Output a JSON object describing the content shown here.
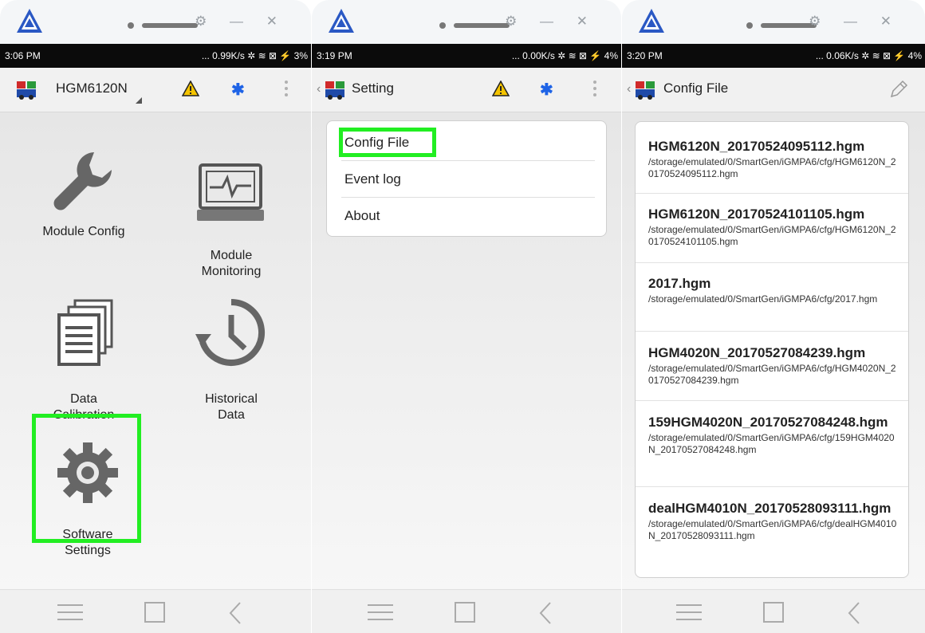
{
  "panels": [
    {
      "status": {
        "time": "3:06 PM",
        "right": "... 0.99K/s ✲ ≋ ⊠ ⚡ 3%"
      },
      "appbar": {
        "title": "HGM6120N"
      },
      "tiles": [
        "Module Config",
        "Module\nMonitoring",
        "Data\nCalibration",
        "Historical\nData",
        "Software\nSettings"
      ]
    },
    {
      "status": {
        "time": "3:19 PM",
        "right": "... 0.00K/s ✲ ≋ ⊠ ⚡ 4%"
      },
      "appbar": {
        "title": "Setting"
      },
      "menu": [
        "Config File",
        "Event log",
        "About"
      ]
    },
    {
      "status": {
        "time": "3:20 PM",
        "right": "... 0.06K/s ✲ ≋ ⊠ ⚡ 4%"
      },
      "appbar": {
        "title": "Config File"
      },
      "files": [
        {
          "name": "HGM6120N_20170524095112.hgm",
          "path": "/storage/emulated/0/SmartGen/iGMPA6/cfg/HGM6120N_20170524095112.hgm"
        },
        {
          "name": "HGM6120N_20170524101105.hgm",
          "path": "/storage/emulated/0/SmartGen/iGMPA6/cfg/HGM6120N_20170524101105.hgm"
        },
        {
          "name": "2017.hgm",
          "path": "/storage/emulated/0/SmartGen/iGMPA6/cfg/2017.hgm"
        },
        {
          "name": "HGM4020N_20170527084239.hgm",
          "path": "/storage/emulated/0/SmartGen/iGMPA6/cfg/HGM4020N_20170527084239.hgm"
        },
        {
          "name": "159HGM4020N_20170527084248.hgm",
          "path": "/storage/emulated/0/SmartGen/iGMPA6/cfg/159HGM4020N_20170527084248.hgm"
        },
        {
          "name": "dealHGM4010N_20170528093111.hgm",
          "path": "/storage/emulated/0/SmartGen/iGMPA6/cfg/dealHGM4010N_20170528093111.hgm"
        }
      ]
    }
  ],
  "icons": {
    "app_logo": "logo-icon",
    "module_icon": "generator-icon",
    "warning": "warning-icon",
    "bluetooth": "bluetooth-icon",
    "overflow": "overflow-menu-icon",
    "edit": "pencil-icon",
    "wrench": "wrench-icon",
    "monitor": "monitor-icon",
    "documents": "documents-icon",
    "history": "history-icon",
    "gear": "gear-icon"
  },
  "colors": {
    "highlight": "#22ee22",
    "bluetooth": "#1e63e6",
    "warning": "#f5c400",
    "status_bar": "#0b0b0b"
  }
}
